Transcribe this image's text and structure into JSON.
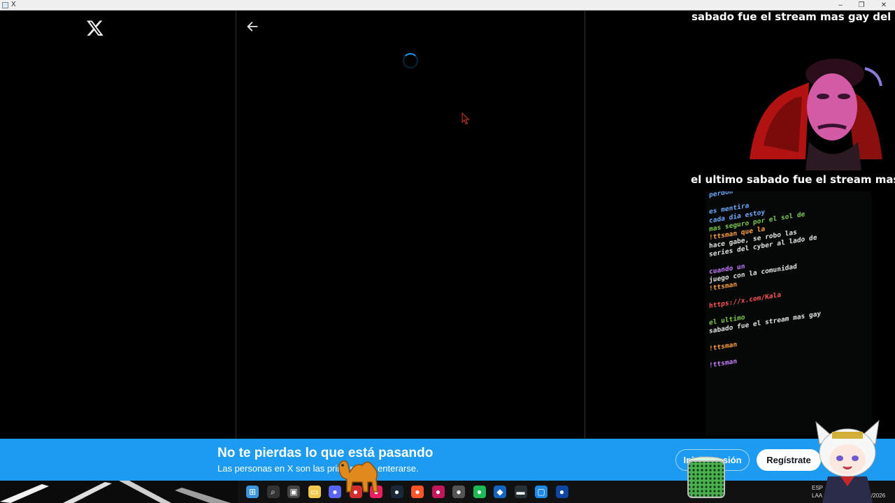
{
  "window": {
    "title": "X",
    "controls": [
      "–",
      "❐",
      "✕"
    ]
  },
  "x_app": {
    "logo": "x-logo-icon",
    "back": "back-arrow-icon",
    "loading": true
  },
  "stream_overlay": {
    "top_text": "sabado fue el stream mas gay del m",
    "mid_text": "el ultimo sabado fue el stream mas",
    "chat": [
      {
        "user": "",
        "text": "perdon",
        "color": "#6ea8ff"
      },
      {
        "user": "",
        "text": "",
        "color": "#7ec850"
      },
      {
        "user": "",
        "text": "es mentira",
        "color": "#6ea8ff"
      },
      {
        "user": "",
        "text": "cada dia estoy",
        "color": "#6ea8ff"
      },
      {
        "user": "",
        "text": "mas seguro por el sol de",
        "color": "#7ec850"
      },
      {
        "user": "",
        "text": "!ttsman que la",
        "color": "#ff9f43"
      },
      {
        "user": "",
        "text": "hace gabe, se robo las",
        "color": "#dfe6df"
      },
      {
        "user": "",
        "text": "series del cyber al lado de",
        "color": "#dfe6df"
      },
      {
        "user": "",
        "text": "",
        "color": "#dfe6df"
      },
      {
        "user": "",
        "text": "cuando un",
        "color": "#c77dff"
      },
      {
        "user": "",
        "text": "juego con la comunidad",
        "color": "#dfe6df"
      },
      {
        "user": "",
        "text": "!ttsman",
        "color": "#ff9f43"
      },
      {
        "user": "",
        "text": "",
        "color": "#dfe6df"
      },
      {
        "user": "",
        "text": "https://x.com/Kala",
        "color": "#ff5555"
      },
      {
        "user": "",
        "text": "",
        "color": "#dfe6df"
      },
      {
        "user": "",
        "text": "el ultimo",
        "color": "#7ec850"
      },
      {
        "user": "",
        "text": "sabado fue el stream mas gay",
        "color": "#dfe6df"
      },
      {
        "user": "",
        "text": "",
        "color": "#dfe6df"
      },
      {
        "user": "",
        "text": "!ttsman",
        "color": "#ff9f43"
      },
      {
        "user": "",
        "text": "",
        "color": "#dfe6df"
      },
      {
        "user": "",
        "text": "!ttsman",
        "color": "#c77dff"
      }
    ]
  },
  "banner": {
    "title": "No te pierdas lo que está pasando",
    "subtitle": "Las personas en X son las primeras en enterarse.",
    "login_label": "Iniciar sesión",
    "register_label": "Regístrate",
    "color": "#1d9bf0"
  },
  "taskbar": {
    "icons": [
      {
        "name": "windows-start-icon",
        "color": "#3a96dd",
        "glyph": "⊞"
      },
      {
        "name": "search-icon",
        "color": "#333333",
        "glyph": "⌕"
      },
      {
        "name": "task-view-icon",
        "color": "#444444",
        "glyph": "▣"
      },
      {
        "name": "file-explorer-icon",
        "color": "#f2c94c",
        "glyph": "▭"
      },
      {
        "name": "discord-icon",
        "color": "#5865f2",
        "glyph": "●"
      },
      {
        "name": "ad-blocker-icon",
        "color": "#d32f2f",
        "glyph": "●"
      },
      {
        "name": "colorful-app-icon",
        "color": "#e91e63",
        "glyph": "●"
      },
      {
        "name": "steam-icon",
        "color": "#1b2838",
        "glyph": "●"
      },
      {
        "name": "brave-browser-icon",
        "color": "#fb542b",
        "glyph": "●"
      },
      {
        "name": "app-circle-icon",
        "color": "#c2185b",
        "glyph": "●"
      },
      {
        "name": "chrome-style-icon",
        "color": "#555555",
        "glyph": "●"
      },
      {
        "name": "spotify-icon",
        "color": "#1db954",
        "glyph": "●"
      },
      {
        "name": "blue-diamond-icon",
        "color": "#1565c0",
        "glyph": "◆"
      },
      {
        "name": "monitor-app-icon",
        "color": "#263238",
        "glyph": "▬"
      },
      {
        "name": "window-app-icon",
        "color": "#1e88e5",
        "glyph": "▢"
      },
      {
        "name": "steam-blue-icon",
        "color": "#0d47a1",
        "glyph": "●"
      }
    ],
    "tray_lang": "ESP",
    "tray_lang2": "LAA",
    "tray_date": "17/03/2026"
  }
}
